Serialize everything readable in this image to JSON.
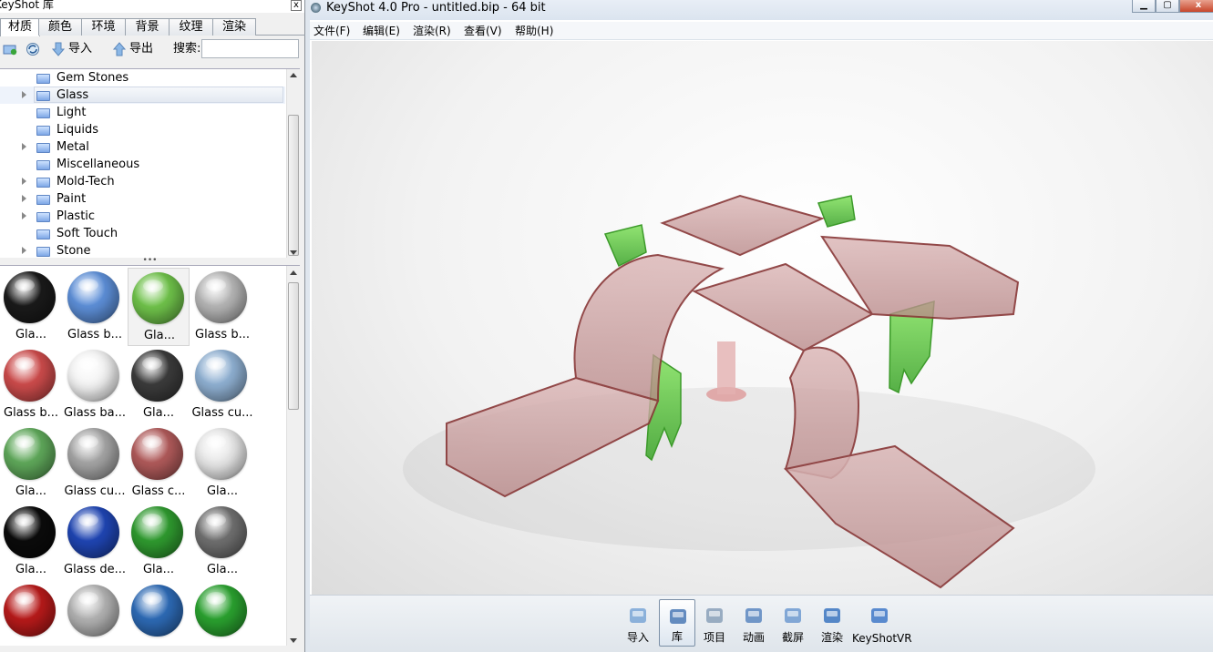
{
  "library": {
    "title": "KeyShot 库",
    "close": "x",
    "tabs": [
      "材质",
      "颜色",
      "环境",
      "背景",
      "纹理",
      "渲染"
    ],
    "toolbar": {
      "import": "导入",
      "export": "导出",
      "search_label": "搜索:",
      "search_value": ""
    },
    "tree": [
      {
        "label": "Gem Stones",
        "expandable": false,
        "selected": false
      },
      {
        "label": "Glass",
        "expandable": true,
        "selected": true
      },
      {
        "label": "Light",
        "expandable": false,
        "selected": false
      },
      {
        "label": "Liquids",
        "expandable": false,
        "selected": false
      },
      {
        "label": "Metal",
        "expandable": true,
        "selected": false
      },
      {
        "label": "Miscellaneous",
        "expandable": false,
        "selected": false
      },
      {
        "label": "Mold-Tech",
        "expandable": true,
        "selected": false
      },
      {
        "label": "Paint",
        "expandable": true,
        "selected": false
      },
      {
        "label": "Plastic",
        "expandable": true,
        "selected": false
      },
      {
        "label": "Soft Touch",
        "expandable": false,
        "selected": false
      },
      {
        "label": "Stone",
        "expandable": true,
        "selected": false
      }
    ],
    "splitter": "•••",
    "materials": [
      {
        "name": "Gla...",
        "color": "#1a1a1a"
      },
      {
        "name": "Glass b...",
        "color": "#5d8fd8"
      },
      {
        "name": "Gla...",
        "color": "#6fc24a",
        "selected": true
      },
      {
        "name": "Glass b...",
        "color": "#b5b5b5"
      },
      {
        "name": "Glass b...",
        "color": "#cc4b4b"
      },
      {
        "name": "Glass ba...",
        "color": "#f4f4f4"
      },
      {
        "name": "Gla...",
        "color": "#3b3b3b"
      },
      {
        "name": "Glass cu...",
        "color": "#8fb0d2"
      },
      {
        "name": "Gla...",
        "color": "#5fa85a"
      },
      {
        "name": "Glass cu...",
        "color": "#a5a5a5"
      },
      {
        "name": "Glass c...",
        "color": "#b05a5a"
      },
      {
        "name": "Gla...",
        "color": "#e8e8e8"
      },
      {
        "name": "Gla...",
        "color": "#0b0b0b"
      },
      {
        "name": "Glass de...",
        "color": "#1f45b3"
      },
      {
        "name": "Gla...",
        "color": "#2f9a2f"
      },
      {
        "name": "Gla...",
        "color": "#6f6f6f"
      },
      {
        "name": "",
        "color": "#b71a1a"
      },
      {
        "name": "",
        "color": "#b2b2b2"
      },
      {
        "name": "",
        "color": "#2d6ab5"
      },
      {
        "name": "",
        "color": "#2aa12f"
      }
    ]
  },
  "window": {
    "title": "KeyShot 4.0 Pro  - untitled.bip  - 64 bit",
    "min": "▁",
    "max": "▢",
    "close": "x",
    "menu": [
      "文件(F)",
      "编辑(E)",
      "渲染(R)",
      "查看(V)",
      "帮助(H)"
    ]
  },
  "bottombar": [
    {
      "label": "导入",
      "icon": "import-icon",
      "active": false
    },
    {
      "label": "库",
      "icon": "library-icon",
      "active": true
    },
    {
      "label": "项目",
      "icon": "project-icon",
      "active": false
    },
    {
      "label": "动画",
      "icon": "animation-icon",
      "active": false
    },
    {
      "label": "截屏",
      "icon": "screenshot-icon",
      "active": false
    },
    {
      "label": "渲染",
      "icon": "render-teapot-icon",
      "active": false
    },
    {
      "label": "KeyShotVR",
      "icon": "keyshotvr-icon",
      "active": false
    }
  ],
  "colors": {
    "glass_pink": "#c89898",
    "chair_green": "#55cc33",
    "accent": "#3a6ea5"
  }
}
